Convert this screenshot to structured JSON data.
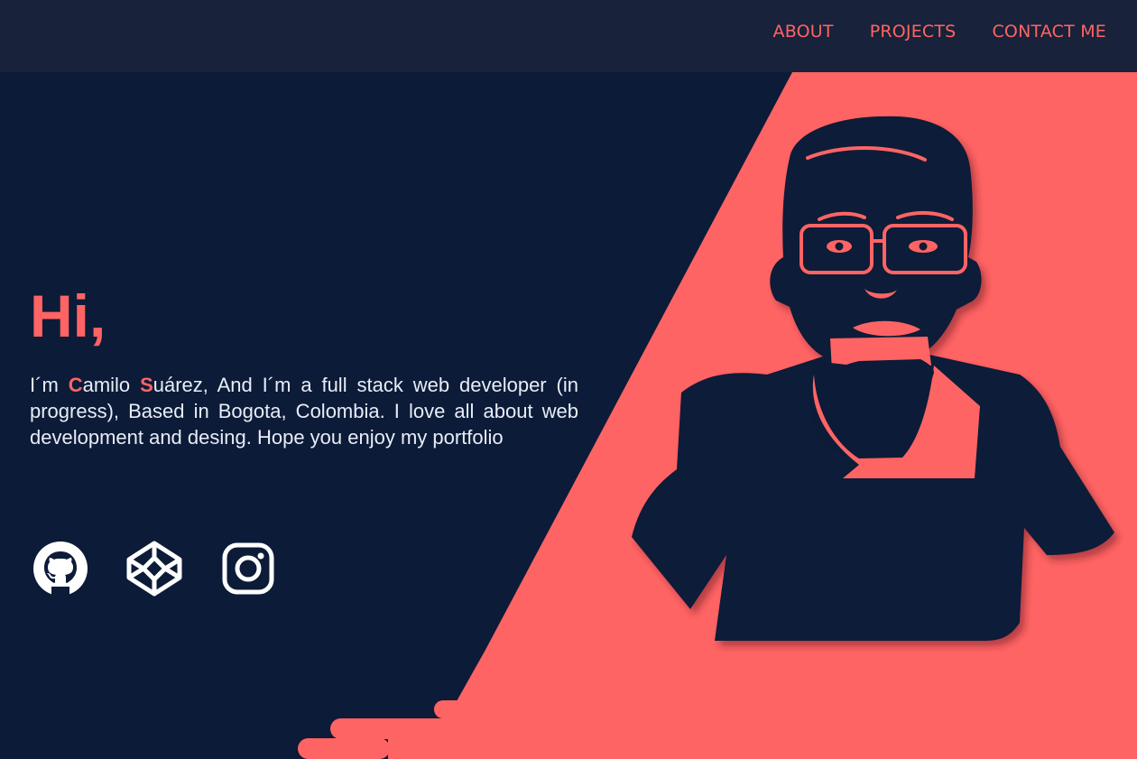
{
  "nav": {
    "about": "ABOUT",
    "projects": "PROJECTS",
    "contact": "CONTACT ME"
  },
  "hero": {
    "title": "Hi,",
    "intro_prefix": "I´m ",
    "first_initial": "C",
    "first_rest": "amilo ",
    "last_initial": "S",
    "last_rest": "uárez, And I´m a full stack web developer (in progress), Based in Bogota, Colombia. I love all about web development and desing. Hope you enjoy my portfolio"
  },
  "social": [
    {
      "name": "github",
      "icon": "github-icon"
    },
    {
      "name": "codepen",
      "icon": "codepen-icon"
    },
    {
      "name": "instagram",
      "icon": "instagram-icon"
    }
  ],
  "colors": {
    "navbar_bg": "#18223a",
    "page_bg": "#0c1b38",
    "accent": "#ff6464",
    "text": "#e8edf6"
  }
}
